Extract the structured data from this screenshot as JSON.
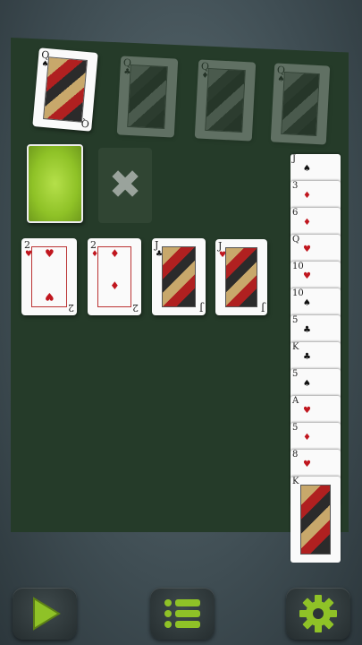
{
  "game": "Solitaire",
  "top_left_card": {
    "rank": "Q",
    "suit": "♠"
  },
  "foundation_placeholders": [
    {
      "rank": "Q",
      "suit": "♣"
    },
    {
      "rank": "Q",
      "suit": "♦"
    },
    {
      "rank": "Q",
      "suit": "♠"
    }
  ],
  "waste_symbol": "✖",
  "row_cards": [
    {
      "rank": "2",
      "suit": "♥",
      "color": "red",
      "bottom": "2"
    },
    {
      "rank": "2",
      "suit": "♦",
      "color": "red",
      "bottom": "2"
    },
    {
      "rank": "J",
      "suit": "♣",
      "color": "black",
      "bottom": "J"
    },
    {
      "rank": "J",
      "suit": "♥",
      "color": "red",
      "bottom": "J"
    }
  ],
  "right_stack": [
    {
      "rank": "J",
      "suit": "♠"
    },
    {
      "rank": "3",
      "suit": "♦"
    },
    {
      "rank": "6",
      "suit": "♦"
    },
    {
      "rank": "Q",
      "suit": "♥"
    },
    {
      "rank": "10",
      "suit": "♥"
    },
    {
      "rank": "10",
      "suit": "♠"
    },
    {
      "rank": "5",
      "suit": "♣"
    },
    {
      "rank": "K",
      "suit": "♣"
    },
    {
      "rank": "5",
      "suit": "♠"
    },
    {
      "rank": "A",
      "suit": "♥"
    },
    {
      "rank": "5",
      "suit": "♦"
    },
    {
      "rank": "8",
      "suit": "♥"
    },
    {
      "rank": "K",
      "suit": "♥"
    }
  ],
  "buttons": {
    "play": "play-icon",
    "menu": "list-menu-icon",
    "settings": "gear-icon"
  },
  "colors": {
    "accent": "#8fc227",
    "felt": "#253b29",
    "red": "#c0161e"
  }
}
